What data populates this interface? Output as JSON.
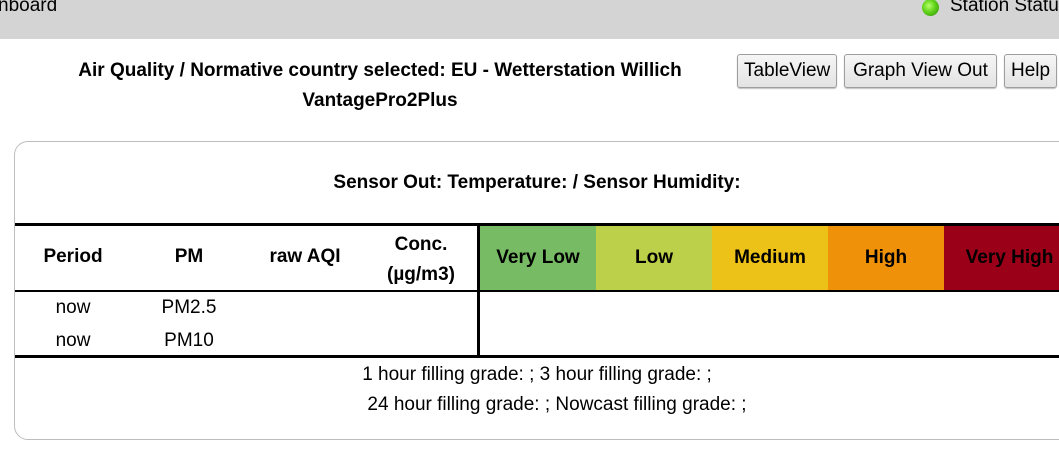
{
  "topbar": {
    "app_title": "nboard",
    "station_status_label": "Station Statu",
    "status_color": "#5fd11a"
  },
  "header": {
    "title_line1": "Air Quality / Normative country selected: EU - Wetterstation Willich",
    "title_line2": "VantagePro2Plus"
  },
  "buttons": {
    "table_view": "TableView",
    "graph_view": "Graph View Out",
    "help": "Help"
  },
  "panel": {
    "sensor_title": "Sensor Out: Temperature: / Sensor Humidity:",
    "columns": {
      "period": "Period",
      "pm": "PM",
      "raw_aqi": "raw AQI",
      "conc_line1": "Conc.",
      "conc_line2": "(µg/m3)"
    },
    "aqi_levels": [
      {
        "label": "Very Low",
        "color": "#77bc65"
      },
      {
        "label": "Low",
        "color": "#bcd04a"
      },
      {
        "label": "Medium",
        "color": "#ecc118"
      },
      {
        "label": "High",
        "color": "#f0910a"
      },
      {
        "label": "Very High",
        "color": "#9a0018"
      }
    ],
    "rows": [
      {
        "period": "now",
        "pm": "PM2.5"
      },
      {
        "period": "now",
        "pm": "PM10"
      }
    ],
    "filling_line1": "1 hour filling grade: ;  3 hour filling grade: ;",
    "filling_line2": "24 hour filling grade: ;  Nowcast filling grade: ;"
  }
}
